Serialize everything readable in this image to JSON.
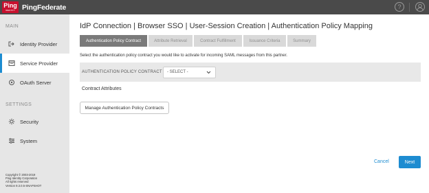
{
  "header": {
    "logo_badge": "Ping",
    "logo_badge_sub": "IDENTITY",
    "logo_text": "PingFederate",
    "help_icon": "help-icon",
    "user_icon": "user-icon"
  },
  "sidebar": {
    "main_section": "MAIN",
    "settings_section": "SETTINGS",
    "items": [
      {
        "label": "Identity Provider",
        "icon": "identity-provider-icon",
        "active": false
      },
      {
        "label": "Service Provider",
        "icon": "service-provider-icon",
        "active": true
      },
      {
        "label": "OAuth Server",
        "icon": "oauth-icon",
        "active": false
      },
      {
        "label": "Security",
        "icon": "security-icon",
        "active": false
      },
      {
        "label": "System",
        "icon": "system-icon",
        "active": false
      }
    ],
    "copyright": [
      "Copyright © 2003-2019",
      "Ping Identity Corporation",
      "All rights reserved",
      "Version 9.3.0.5-SNAPSHOT"
    ]
  },
  "main": {
    "title": "IdP Connection | Browser SSO | User-Session Creation | Authentication Policy Mapping",
    "tabs": [
      {
        "label": "Authentication Policy Contract",
        "active": true
      },
      {
        "label": "Attribute Retrieval",
        "active": false
      },
      {
        "label": "Contract Fulfillment",
        "active": false
      },
      {
        "label": "Issuance Criteria",
        "active": false
      },
      {
        "label": "Summary",
        "active": false
      }
    ],
    "intro": "Select the authentication policy contract you would like to activate for incoming SAML messages from this partner.",
    "contract_label": "AUTHENTICATION POLICY CONTRACT",
    "contract_select_value": "- SELECT -",
    "contract_attributes_heading": "Contract Attributes",
    "manage_button": "Manage Authentication Policy Contracts",
    "cancel_button": "Cancel",
    "next_button": "Next"
  },
  "colors": {
    "topbar": "#4a4a4a",
    "accent": "#1d8cd1",
    "brand_red": "#c8102e",
    "sidebar_bg": "#e6e6e6"
  }
}
